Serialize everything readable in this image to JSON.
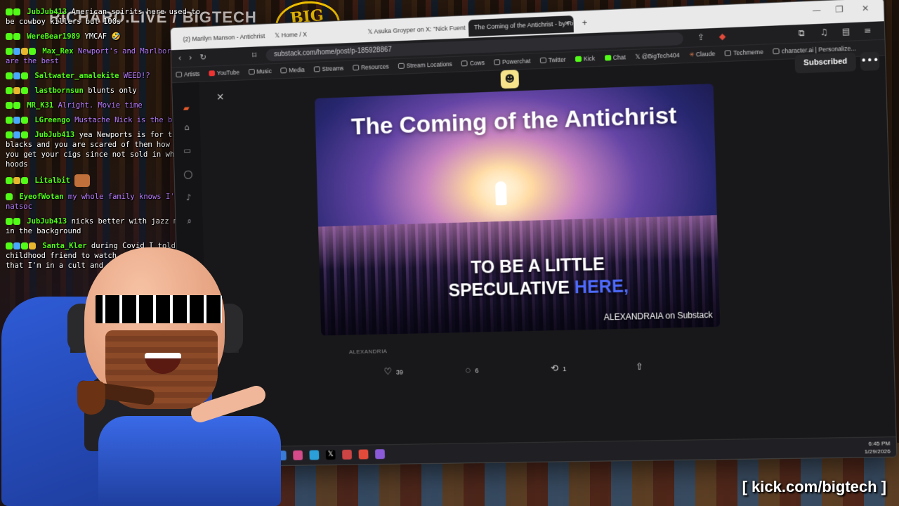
{
  "stream": {
    "logo_text": "BIG TECH",
    "logo_url_text": "RICHARD.LIVE / BIGTECH",
    "watermark": "[ kick.com/bigtech ]"
  },
  "chat": {
    "messages": [
      {
        "user": "JubJub413",
        "text": "American spirits here used to be cowboy killers but 100s"
      },
      {
        "user": "WereBear1989",
        "text": "YMCAF 🤣"
      },
      {
        "user": "Max_Rex",
        "text": "Newport's and Marlboro reds are the best"
      },
      {
        "user": "Saltwater_amalekite",
        "text": "WEED!?"
      },
      {
        "user": "lastbornsun",
        "text": "blunts only"
      },
      {
        "user": "MR_K31",
        "text": "Alright. Movie time"
      },
      {
        "user": "LGreengo",
        "text": "Mustache Nick is the best"
      },
      {
        "user": "JubJub413",
        "text": "yea Newports is for the blacks and you are scared of them how would you get your cigs since not sold in whites hoods"
      },
      {
        "user": "Litalbit",
        "text": ""
      },
      {
        "user": "EyeofWotan",
        "text": "my whole family knows I'm natsoc"
      },
      {
        "user": "JubJub413",
        "text": "nicks better with jazz music in the background"
      },
      {
        "user": "Santa_Kler",
        "text": "during Covid I told my childhood friend to watch nick and said that I'm in a cult and th..."
      }
    ]
  },
  "browser": {
    "tabs": [
      {
        "label": "(2) Marilyn Manson - Antichrist Superstar (C..."
      },
      {
        "label": "Home / X"
      },
      {
        "label": "Asuka Groyper on X: \"Nick Fuentes warn..."
      },
      {
        "label": "The Coming of the Antichrist - by Rich..."
      }
    ],
    "new_tab": "+",
    "url": "substack.com/home/post/p-185928867",
    "bookmarks": [
      "Artists",
      "YouTube",
      "Music",
      "Media",
      "Streams",
      "Resources",
      "Stream Locations",
      "Cows",
      "Powerchat",
      "Twitter",
      "Kick",
      "Chat",
      "@BigTech404",
      "Claude",
      "Techmeme",
      "character.ai | Personalize..."
    ],
    "subscribed_label": "Subscribed",
    "more_label": "•••",
    "close_label": "×"
  },
  "post": {
    "hero_title": "The Coming of the Antichrist",
    "hero_sub_line1": "TO BE A LITTLE",
    "hero_sub_line2_a": "SPECULATIVE ",
    "hero_sub_line2_b": "HERE,",
    "hero_credit": "ALEXANDRAIA on Substack",
    "author": "ALEXANDRIA",
    "likes": "39",
    "comments": "6",
    "restacks": "1"
  },
  "taskbar": {
    "time": "6:45 PM",
    "date": "1/29/2026"
  },
  "colors": {
    "accent_blue": "#4e6bff",
    "kick_green": "#53fc18",
    "logo_gold": "#f2c200"
  }
}
